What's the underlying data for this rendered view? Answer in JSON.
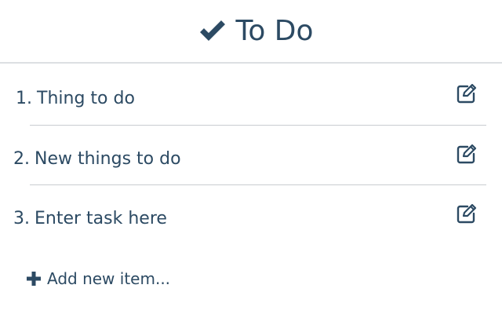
{
  "header": {
    "icon": "checkmark-icon",
    "title": "To Do"
  },
  "tasks": [
    {
      "number": "1.",
      "text": "Thing to do",
      "edit_icon": "edit-icon"
    },
    {
      "number": "2.",
      "text": "New things to do",
      "edit_icon": "edit-icon"
    },
    {
      "number": "3.",
      "text": "Enter task here",
      "edit_icon": "edit-icon"
    }
  ],
  "add_item": {
    "icon": "plus-icon",
    "label": "Add new item..."
  },
  "colors": {
    "text": "#2c4a63",
    "divider": "#c9ccd0",
    "background": "#ffffff"
  }
}
